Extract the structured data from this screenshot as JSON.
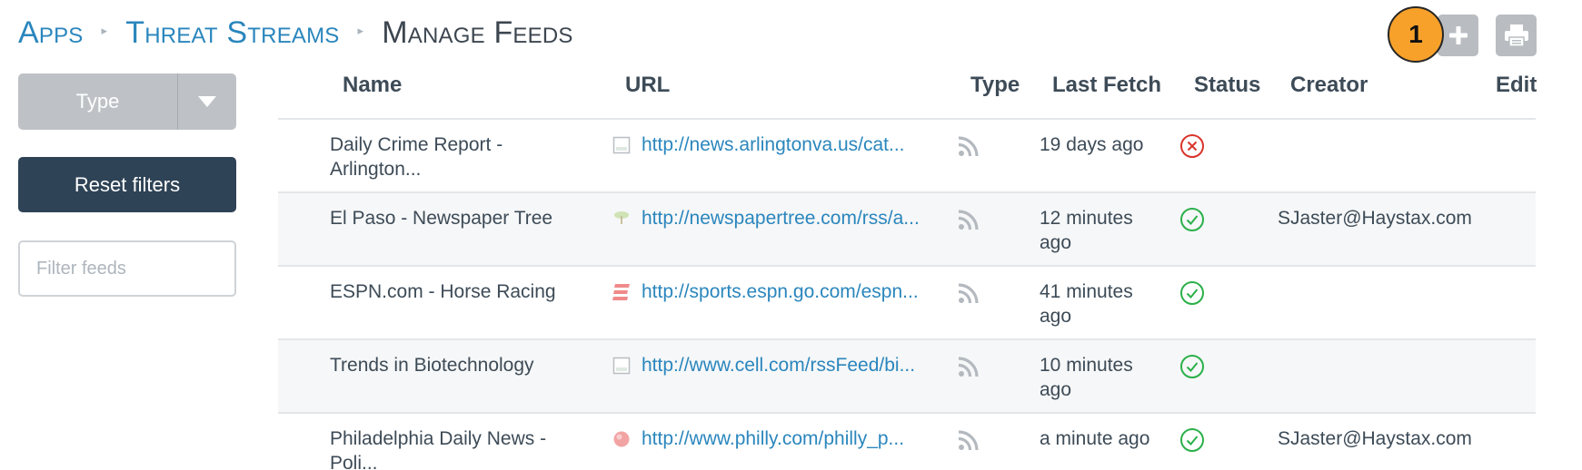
{
  "breadcrumb": {
    "items": [
      "Apps",
      "Threat Streams"
    ],
    "current": "Manage Feeds"
  },
  "actions": {
    "add_icon": "plus-icon",
    "print_icon": "printer-icon",
    "step_badge": "1"
  },
  "sidebar": {
    "type_filter_label": "Type",
    "reset_label": "Reset filters",
    "filter_placeholder": "Filter feeds",
    "filter_value": ""
  },
  "table": {
    "columns": [
      "Name",
      "URL",
      "Type",
      "Last Fetch",
      "Status",
      "Creator",
      "Edit"
    ],
    "rows": [
      {
        "name": "Daily Crime Report - Arlington...",
        "favicon": "blank-page-icon",
        "url": "http://news.arlingtonva.us/cat...",
        "type_icon": "rss-icon",
        "last_fetch": "19 days ago",
        "status": "error",
        "creator": ""
      },
      {
        "name": "El Paso - Newspaper Tree",
        "favicon": "tree-favicon-icon",
        "url": "http://newspapertree.com/rss/a...",
        "type_icon": "rss-icon",
        "last_fetch": "12 minutes ago",
        "status": "ok",
        "creator": "SJaster@Haystax.com"
      },
      {
        "name": "ESPN.com - Horse Racing",
        "favicon": "espn-favicon-icon",
        "url": "http://sports.espn.go.com/espn...",
        "type_icon": "rss-icon",
        "last_fetch": "41 minutes ago",
        "status": "ok",
        "creator": ""
      },
      {
        "name": "Trends in Biotechnology",
        "favicon": "blank-page-icon",
        "url": "http://www.cell.com/rssFeed/bi...",
        "type_icon": "rss-icon",
        "last_fetch": "10 minutes ago",
        "status": "ok",
        "creator": ""
      },
      {
        "name": "Philadelphia Daily News - Poli...",
        "favicon": "red-ball-favicon-icon",
        "url": "http://www.philly.com/philly_p...",
        "type_icon": "rss-icon",
        "last_fetch": "a minute ago",
        "status": "ok",
        "creator": "SJaster@Haystax.com"
      }
    ]
  },
  "colors": {
    "link": "#2a86bd",
    "reset_button": "#2f4356",
    "type_button": "#bec2c6",
    "status_ok": "#2bb04a",
    "status_error": "#d9342b",
    "badge": "#f7a12b"
  }
}
